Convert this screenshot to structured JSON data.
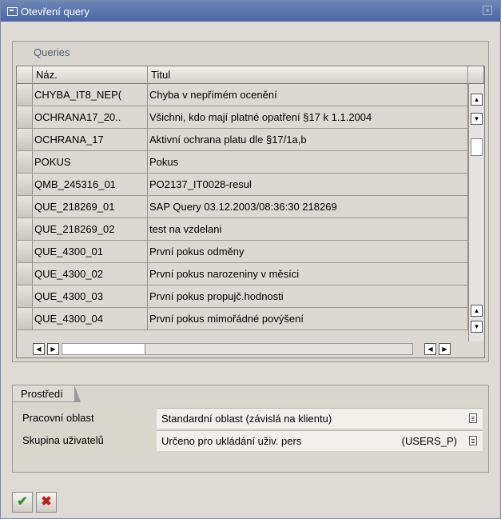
{
  "window": {
    "title": "Otevření query"
  },
  "queries_group": {
    "title": "Queries",
    "columns": [
      "Náz.",
      "Titul"
    ],
    "rows": [
      {
        "name": "CHYBA_IT8_NEP(",
        "title": "Chyba v nepřímém ocenění"
      },
      {
        "name": "OCHRANA17_20..",
        "title": "Všichni, kdo mají platné opatření §17 k 1.1.2004"
      },
      {
        "name": "OCHRANA_17",
        "title": "Aktivní ochrana platu dle §17/1a,b"
      },
      {
        "name": "POKUS",
        "title": "Pokus"
      },
      {
        "name": "QMB_245316_01",
        "title": "PO2137_IT0028-resul"
      },
      {
        "name": "QUE_218269_01",
        "title": "SAP Query 03.12.2003/08:36:30 218269"
      },
      {
        "name": "QUE_218269_02",
        "title": "test na vzdelani"
      },
      {
        "name": "QUE_4300_01",
        "title": "První pokus odměny"
      },
      {
        "name": "QUE_4300_02",
        "title": "První pokus narozeniny v měsíci"
      },
      {
        "name": "QUE_4300_03",
        "title": "První pokus propujč.hodnosti"
      },
      {
        "name": "QUE_4300_04",
        "title": "První pokus mimořádné povýšení"
      }
    ]
  },
  "environment_group": {
    "title": "Prostředí",
    "fields": [
      {
        "label": "Pracovní oblast",
        "value": "Standardní oblast (závislá na klientu)",
        "code": ""
      },
      {
        "label": "Skupina uživatelů",
        "value": "Určeno pro ukládání uživ. pers",
        "code": "(USERS_P)"
      }
    ]
  },
  "buttons": {
    "confirm_icon": "check-icon",
    "cancel_icon": "cancel-icon"
  }
}
